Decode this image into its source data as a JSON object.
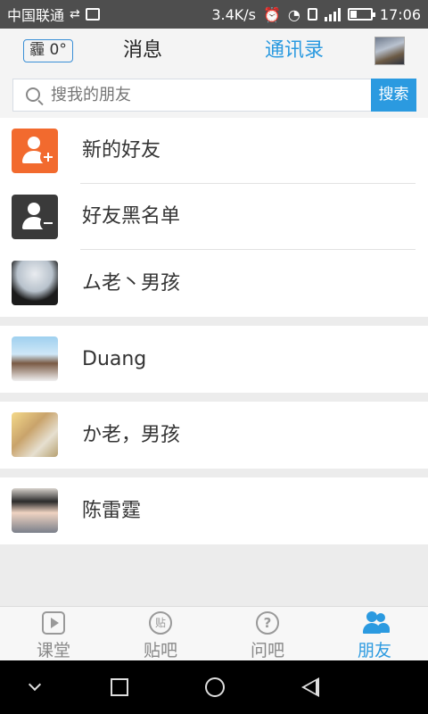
{
  "status_bar": {
    "carrier": "中国联通",
    "network_speed": "3.4K/s",
    "time": "17:06",
    "icons": [
      "usb-icon",
      "image-icon",
      "alarm-icon",
      "wifi-icon",
      "sim-icon",
      "signal-icon",
      "battery-icon"
    ]
  },
  "header": {
    "weather": "霾 0°",
    "tab_messages": "消息",
    "tab_contacts": "通讯录",
    "active_tab": "通讯录",
    "accent_color": "#2b9ae0"
  },
  "search": {
    "placeholder": "搜我的朋友",
    "button_label": "搜索"
  },
  "list": {
    "new_friends": "新的好友",
    "blacklist": "好友黑名单",
    "friends": [
      {
        "name": "ム老丶男孩"
      },
      {
        "name": "Duang"
      },
      {
        "name": "か老，男孩"
      },
      {
        "name": "陈雷霆"
      }
    ]
  },
  "bottom_nav": {
    "items": [
      {
        "label": "课堂",
        "icon": "video-class-icon"
      },
      {
        "label": "贴吧",
        "icon": "post-icon",
        "glyph": "贴"
      },
      {
        "label": "问吧",
        "icon": "question-icon",
        "glyph": "?"
      },
      {
        "label": "朋友",
        "icon": "friends-icon"
      }
    ],
    "active": "朋友"
  }
}
